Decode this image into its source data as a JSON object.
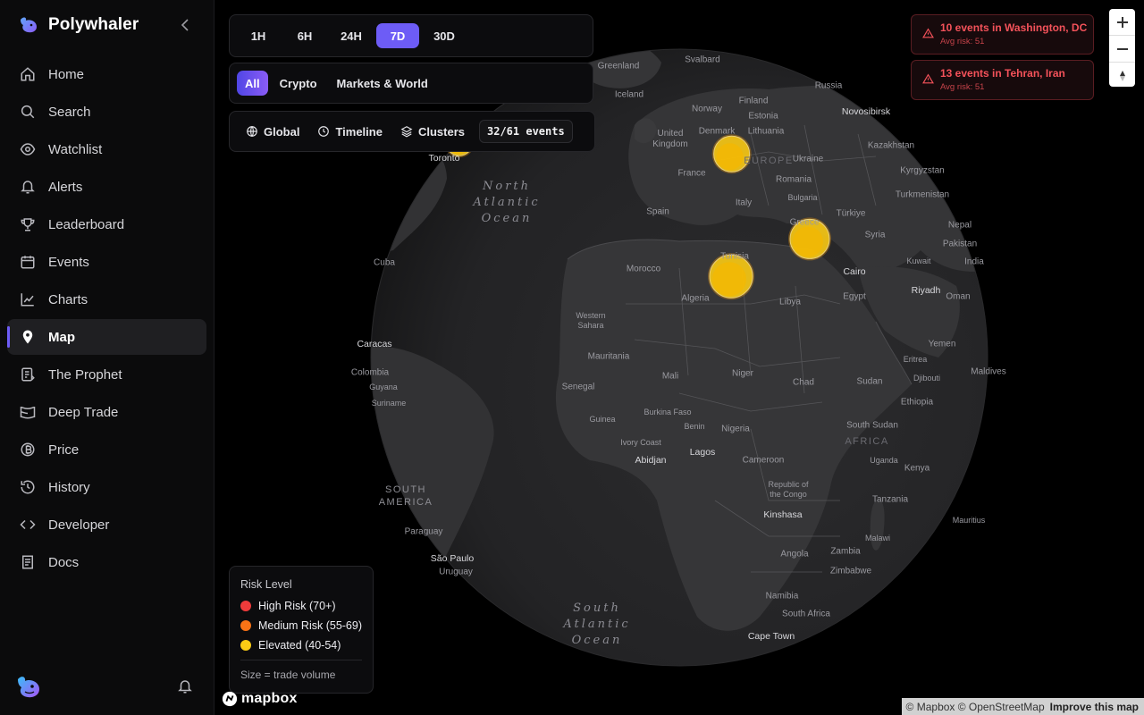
{
  "app": {
    "name": "Polywhaler",
    "brand_color": "#6d5cf6"
  },
  "sidebar": {
    "items": [
      {
        "label": "Home",
        "icon": "home-icon"
      },
      {
        "label": "Search",
        "icon": "search-icon"
      },
      {
        "label": "Watchlist",
        "icon": "eye-icon"
      },
      {
        "label": "Alerts",
        "icon": "bell-icon"
      },
      {
        "label": "Leaderboard",
        "icon": "trophy-icon"
      },
      {
        "label": "Events",
        "icon": "calendar-icon"
      },
      {
        "label": "Charts",
        "icon": "chart-icon"
      },
      {
        "label": "Map",
        "icon": "map-pin-icon",
        "active": true
      },
      {
        "label": "The Prophet",
        "icon": "prophet-icon"
      },
      {
        "label": "Deep Trade",
        "icon": "deep-trade-icon"
      },
      {
        "label": "Price",
        "icon": "coin-icon"
      },
      {
        "label": "History",
        "icon": "history-icon"
      },
      {
        "label": "Developer",
        "icon": "code-icon"
      },
      {
        "label": "Docs",
        "icon": "book-icon"
      }
    ]
  },
  "filters": {
    "time_ranges": [
      "1H",
      "6H",
      "24H",
      "7D",
      "30D"
    ],
    "active_time_range": "7D",
    "categories": [
      "All",
      "Crypto",
      "Markets & World"
    ],
    "active_category": "All",
    "views": [
      {
        "label": "Global",
        "icon": "globe-icon"
      },
      {
        "label": "Timeline",
        "icon": "clock-icon"
      },
      {
        "label": "Clusters",
        "icon": "layers-icon"
      }
    ],
    "event_count": "32/61 events"
  },
  "alerts": [
    {
      "title": "10 events in Washington, DC",
      "subtitle": "Avg risk: 51"
    },
    {
      "title": "13 events in Tehran, Iran",
      "subtitle": "Avg risk: 51"
    }
  ],
  "legend": {
    "title": "Risk Level",
    "items": [
      {
        "label": "High Risk (70+)",
        "color": "#ef3b3b"
      },
      {
        "label": "Medium Risk (55-69)",
        "color": "#f97316"
      },
      {
        "label": "Elevated (40-54)",
        "color": "#facc15"
      }
    ],
    "note": "Size = trade volume"
  },
  "map_labels": {
    "oceans": [
      "North\nAtlantic\nOcean",
      "South\nAtlantic\nOcean"
    ],
    "regions": [
      "SOUTH\nAMERICA",
      "AFRICA",
      "EUROPE"
    ],
    "places": [
      "Greenland",
      "Svalbard",
      "Iceland",
      "Finland",
      "Russia",
      "Norway",
      "Estonia",
      "Novosibirsk",
      "United Kingdom",
      "Denmark",
      "Lithuania",
      "Kazakhstan",
      "Ukraine",
      "France",
      "Romania",
      "Kyrgyzstan",
      "Italy",
      "Bulgaria",
      "Turkmenistan",
      "Spain",
      "Türkiye",
      "Greece",
      "Nepal",
      "Syria",
      "Pakistan",
      "Toronto",
      "Morocco",
      "Tunisia",
      "Kuwait",
      "India",
      "Cairo",
      "Riyadh",
      "Oman",
      "Cuba",
      "Algeria",
      "Libya",
      "Egypt",
      "Western Sahara",
      "Caracas",
      "Mauritania",
      "Yemen",
      "Maldives",
      "Colombia",
      "Mali",
      "Niger",
      "Chad",
      "Sudan",
      "Eritrea",
      "Djibouti",
      "Guyana",
      "Senegal",
      "Suriname",
      "Ethiopia",
      "Guinea",
      "Burkina Faso",
      "Benin",
      "Nigeria",
      "Ivory Coast",
      "South Sudan",
      "Abidjan",
      "Lagos",
      "Cameroon",
      "Uganda",
      "Republic of the Congo",
      "Kenya",
      "Tanzania",
      "Kinshasa",
      "Mauritius",
      "Paraguay",
      "Malawi",
      "São Paulo",
      "Uruguay",
      "Angola",
      "Zambia",
      "Zimbabwe",
      "Namibia",
      "South Africa",
      "Cape Town"
    ]
  },
  "markers": [
    {
      "location": "Toronto region",
      "lat": 43.7,
      "lon": -79.4,
      "risk": "elevated"
    },
    {
      "location": "Moscow region",
      "lat": 55.8,
      "lon": 37.6,
      "risk": "elevated"
    },
    {
      "location": "Tehran, Iran",
      "lat": 35.7,
      "lon": 51.4,
      "risk": "elevated"
    },
    {
      "location": "Cairo region",
      "lat": 30.0,
      "lon": 31.2,
      "risk": "elevated"
    }
  ],
  "zoom": {
    "zoom_in": "+",
    "zoom_out": "−"
  },
  "attribution": {
    "logo_text": "mapbox",
    "text": "© Mapbox © OpenStreetMap",
    "improve": "Improve this map"
  }
}
